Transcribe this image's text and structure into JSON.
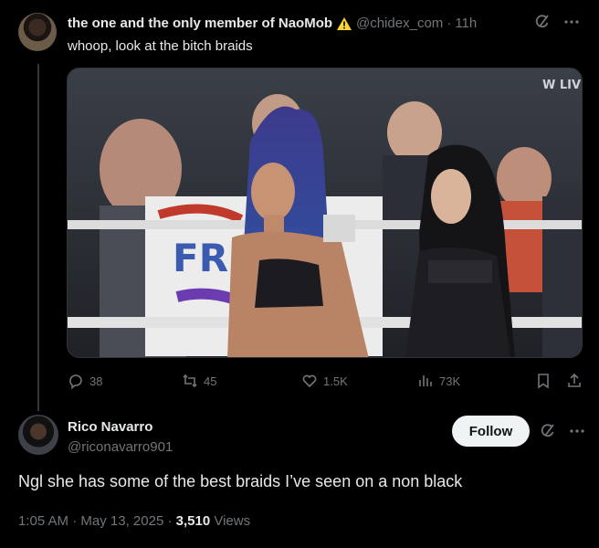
{
  "quoted_tweet": {
    "display_name": "the one and the only member of NaoMob",
    "handle": "@chidex_com",
    "separator": "·",
    "time": "11h",
    "text": "whoop, look at the bitch braids",
    "media": {
      "watermark": "W LIVE",
      "sign_text": "FR"
    },
    "stats": {
      "replies": "38",
      "reposts": "45",
      "likes": "1.5K",
      "views": "73K"
    }
  },
  "reply": {
    "display_name": "Rico Navarro",
    "handle": "@riconavarro901",
    "follow_label": "Follow",
    "text": "Ngl she has some of the best braids I’ve seen on a non black",
    "time": "1:05 AM",
    "date": "May 13, 2025",
    "separator": "·",
    "views_count": "3,510",
    "views_label": "Views"
  },
  "colors": {
    "background": "#000000",
    "text_primary": "#e7e9ea",
    "text_secondary": "#71767b",
    "warning_yellow": "#ffd43b"
  }
}
